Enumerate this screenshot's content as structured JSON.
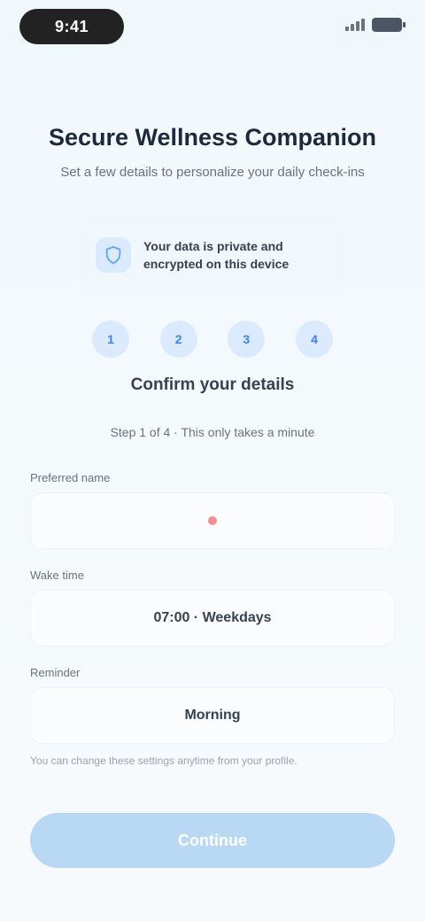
{
  "status": {
    "time": "9:41"
  },
  "header": {
    "title": "Secure Wellness Companion",
    "subtitle": "Set a few details to personalize your daily check-ins"
  },
  "info": {
    "text": "Your data is private and encrypted on this device",
    "icon": "shield-icon"
  },
  "steps": {
    "items": [
      "1",
      "2",
      "3",
      "4"
    ],
    "heading": "Confirm your details",
    "subheading": "Step 1 of 4 · This only takes a minute"
  },
  "form": {
    "field1": {
      "label": "Preferred name",
      "value": ""
    },
    "field2": {
      "label": "Wake time",
      "value": "07:00 · Weekdays"
    },
    "field3": {
      "label": "Reminder",
      "value": "Morning"
    },
    "note": "You can change these settings anytime from your profile."
  },
  "cta": {
    "label": "Continue"
  },
  "colors": {
    "accent": "#3b82f6",
    "cta_bg": "#b9d8f3",
    "marker": "#ef4444"
  }
}
